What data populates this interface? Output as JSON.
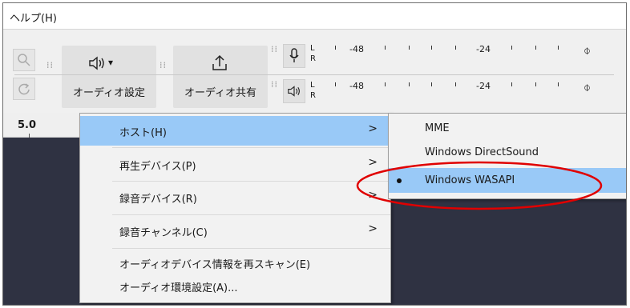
{
  "menubar": {
    "help": "ヘルプ(H)"
  },
  "toolbar": {
    "audio_settings_label": "オーディオ設定",
    "audio_share_label": "オーディオ共有",
    "zoom_icon": "zoom-icon",
    "redo_icon": "redo-icon",
    "speaker_icon": "speaker-icon",
    "share_icon": "share-icon",
    "dropdown_arrow": "▾",
    "record_meter": {
      "l": "L",
      "r": "R",
      "t1": "-48",
      "t2": "-24"
    },
    "play_meter": {
      "l": "L",
      "r": "R",
      "t1": "-48",
      "t2": "-24"
    }
  },
  "ruler": {
    "value": "5.0",
    "right_edge": "1"
  },
  "menu": {
    "items": [
      {
        "label": "ホスト(H)",
        "arrow": ">"
      },
      {
        "label": "再生デバイス(P)",
        "arrow": ">"
      },
      {
        "label": "録音デバイス(R)",
        "arrow": ">"
      },
      {
        "label": "録音チャンネル(C)",
        "arrow": ">"
      },
      {
        "label": "オーディオデバイス情報を再スキャン(E)"
      },
      {
        "label": "オーディオ環境設定(A)..."
      }
    ]
  },
  "submenu": {
    "items": [
      {
        "label": "MME"
      },
      {
        "label": "Windows DirectSound"
      },
      {
        "label": "Windows WASAPI",
        "selected": true
      }
    ]
  },
  "colors": {
    "highlight": "#99c9f7",
    "annotation": "#e00000",
    "track_bg": "#2f3242"
  }
}
